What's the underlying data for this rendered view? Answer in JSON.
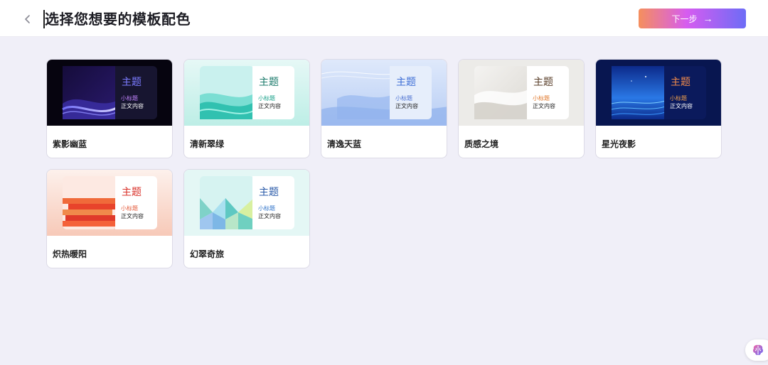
{
  "header": {
    "title": "选择您想要的模板配色",
    "next_label": "下一步",
    "next_arrow": "→"
  },
  "templates": [
    {
      "name": "紫影幽蓝",
      "heading": "主题",
      "subheading": "小标题",
      "body": "正文内容",
      "colors": {
        "bg": "#0a0618",
        "accent": "#7b5cf5",
        "heading": "#7b7bff",
        "subheading": "#c084fc",
        "body": "#ffffff",
        "panel": "#171530"
      }
    },
    {
      "name": "清新翠绿",
      "heading": "主题",
      "subheading": "小标题",
      "body": "正文内容",
      "colors": {
        "bg": "#c8f0ec",
        "accent": "#2cc7c0",
        "heading": "#1b7a6b",
        "subheading": "#17a089",
        "body": "#222222",
        "panel": "#ffffff"
      }
    },
    {
      "name": "清逸天蓝",
      "heading": "主题",
      "subheading": "小标题",
      "body": "正文内容",
      "colors": {
        "bg": "#cfe0f8",
        "accent": "#7fa9ea",
        "heading": "#3f6fd6",
        "subheading": "#4a6fd0",
        "body": "#222222",
        "panel": "#e6eefb"
      }
    },
    {
      "name": "质感之境",
      "heading": "主题",
      "subheading": "小标题",
      "body": "正文内容",
      "colors": {
        "bg": "#ecebe8",
        "accent": "#c9c4bc",
        "heading": "#5a3f2a",
        "subheading": "#e0782b",
        "body": "#222222",
        "panel": "#ffffff"
      }
    },
    {
      "name": "星光夜影",
      "heading": "主题",
      "subheading": "小标题",
      "body": "正文内容",
      "colors": {
        "bg": "#0a1a56",
        "accent": "#4aa8ff",
        "heading": "#f08a4b",
        "subheading": "#f0a04b",
        "body": "#ffffff",
        "panel": "#0b1a5c"
      }
    },
    {
      "name": "炽热暖阳",
      "heading": "主题",
      "subheading": "小标题",
      "body": "正文内容",
      "colors": {
        "bg": "#fbe3dc",
        "accent": "#e8432b",
        "heading": "#d9322a",
        "subheading": "#e45a3a",
        "body": "#222222",
        "panel": "#ffffff"
      }
    },
    {
      "name": "幻翠奇旅",
      "heading": "主题",
      "subheading": "小标题",
      "body": "正文内容",
      "colors": {
        "bg": "#dcf4f2",
        "accent": "#5ec8c2",
        "heading": "#2859a8",
        "subheading": "#2f73c9",
        "body": "#222222",
        "panel": "#ffffff"
      }
    }
  ],
  "icons": {
    "back": "chevron-left-icon",
    "assistant": "brain-icon"
  }
}
